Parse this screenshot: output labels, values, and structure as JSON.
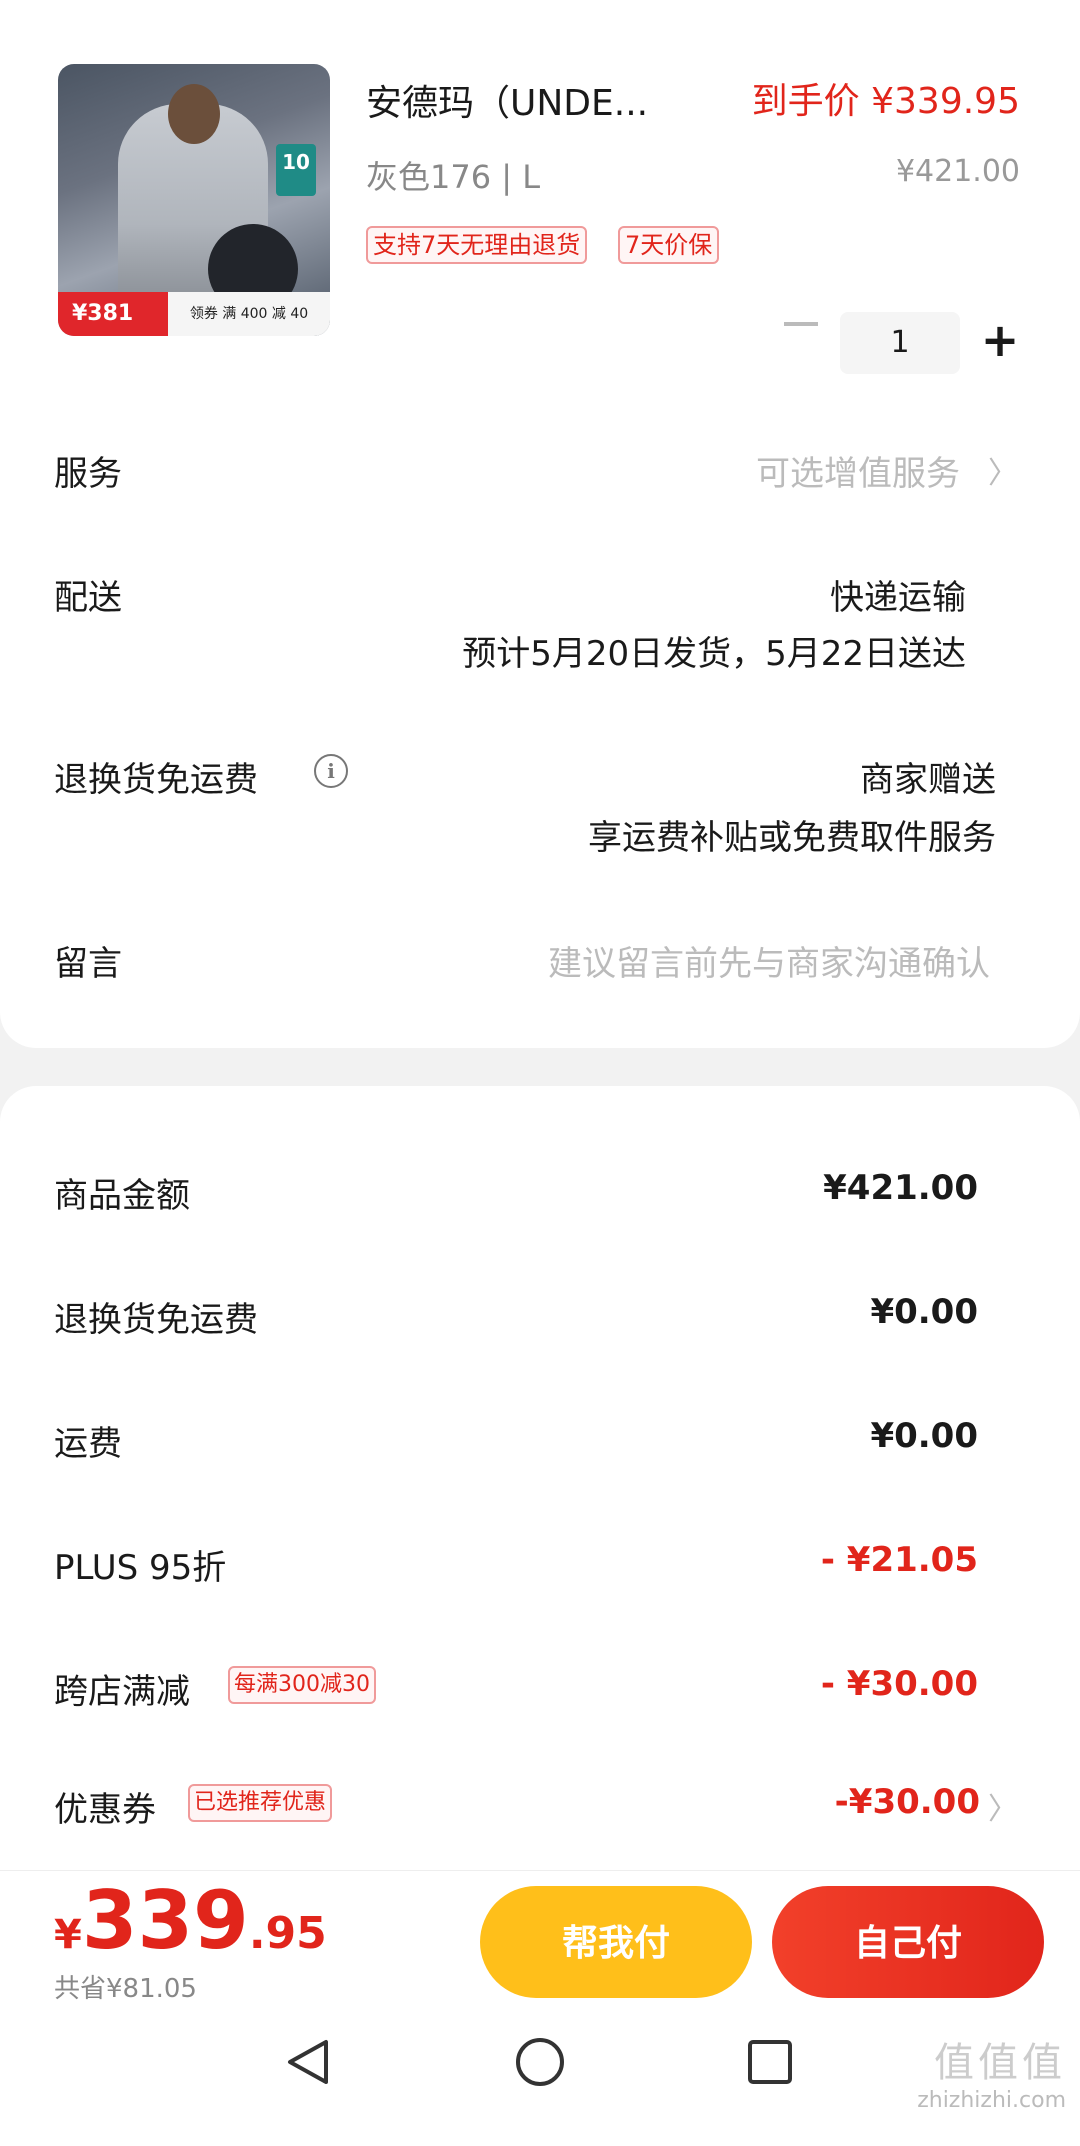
{
  "product": {
    "title": "安德玛（UNDE...",
    "final_price": "到手价 ¥339.95",
    "spec": "灰色176 | L",
    "original_price": "¥421.00",
    "tags": [
      "支持7天无理由退货",
      "7天价保"
    ],
    "image": {
      "badge": "10",
      "price_tag": "¥381",
      "coupon_text": "领券 满 400 减 40"
    },
    "quantity": "1"
  },
  "rows": {
    "service_label": "服务",
    "service_value": "可选增值服务",
    "delivery_label": "配送",
    "delivery_method": "快递运输",
    "delivery_eta": "预计5月20日发货，5月22日送达",
    "return_label": "退换货免运费",
    "return_value1": "商家赠送",
    "return_value2": "享运费补贴或免费取件服务",
    "message_label": "留言",
    "message_placeholder": "建议留言前先与商家沟通确认"
  },
  "summary": {
    "goods_label": "商品金额",
    "goods_value": "¥421.00",
    "return_fee_label": "退换货免运费",
    "return_fee_value": "¥0.00",
    "shipping_label": "运费",
    "shipping_value": "¥0.00",
    "plus_label": "PLUS 95折",
    "plus_value": "- ¥21.05",
    "cross_label": "跨店满减",
    "cross_tag": "每满300减30",
    "cross_value": "- ¥30.00",
    "coupon_label": "优惠券",
    "coupon_tag": "已选推荐优惠",
    "coupon_value": "-¥30.00"
  },
  "footer": {
    "price_yen": "¥",
    "price_int": "339",
    "price_dec": ".95",
    "saved": "共省¥81.05",
    "help_pay": "帮我付",
    "self_pay": "自己付"
  },
  "watermark": {
    "big": "值值值",
    "small": "zhizhizhi.com"
  },
  "colors": {
    "accent_red": "#e1251b",
    "help_yellow": "#ffbf1a"
  },
  "icons": [
    "info-icon",
    "chevron-right-icon",
    "minus-icon",
    "plus-icon",
    "nav-back-icon",
    "nav-home-icon",
    "nav-recents-icon"
  ]
}
